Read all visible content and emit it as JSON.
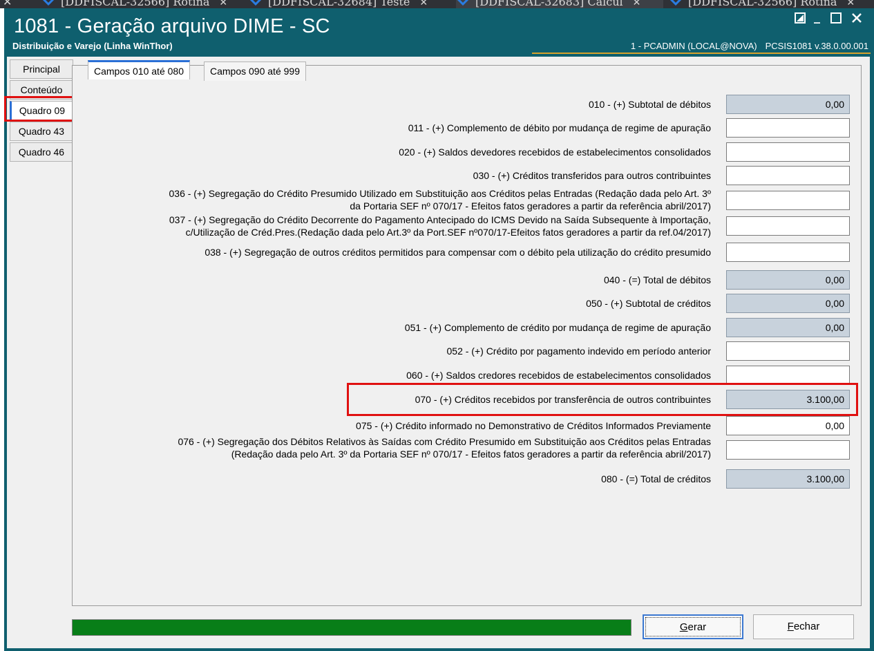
{
  "browser_tabs": [
    {
      "label": "[DDFISCAL-32566] Rotina"
    },
    {
      "label": "[DDFISCAL-32684] Teste"
    },
    {
      "label": "[DDFISCAL-32683] Calcul"
    },
    {
      "label": "[DDFISCAL-32566] Rotina"
    }
  ],
  "window": {
    "title": "1081 - Geração arquivo DIME - SC",
    "subtitle": "Distribuição e Varejo (Linha WinThor)",
    "user": "1 - PCADMIN (LOCAL@NOVA)",
    "system": "PCSIS1081  v.38.0.00.001"
  },
  "side_tabs": [
    {
      "label": "Principal"
    },
    {
      "label": "Conteúdo"
    },
    {
      "label": "Quadro 09"
    },
    {
      "label": "Quadro 43"
    },
    {
      "label": "Quadro 46"
    }
  ],
  "top_tabs": [
    {
      "label": "Campos 010 até 080"
    },
    {
      "label": "Campos 090 até 999"
    }
  ],
  "fields": [
    {
      "label": "010 - (+) Subtotal de débitos",
      "value": "0,00"
    },
    {
      "label": "011 - (+) Complemento de débito por mudança de regime de apuração",
      "value": ""
    },
    {
      "label": "020 - (+) Saldos devedores recebidos de estabelecimentos consolidados",
      "value": ""
    },
    {
      "label": "030 - (+) Créditos transferidos para outros contribuintes",
      "value": ""
    },
    {
      "label": "036 - (+) Segregação do Crédito Presumido Utilizado em Substituição aos Créditos pelas Entradas (Redação dada pelo Art. 3º",
      "label2": "da Portaria SEF nº 070/17 - Efeitos fatos geradores a partir da referência abril/2017)",
      "value": ""
    },
    {
      "label": "037 - (+) Segregação do Crédito Decorrente do Pagamento Antecipado do ICMS Devido na Saída Subsequente à Importação,",
      "label2": "c/Utilização de Créd.Pres.(Redação dada pelo Art.3º da Port.SEF nº070/17-Efeitos fatos geradores a partir da ref.04/2017)",
      "value": ""
    },
    {
      "label": "038 - (+) Segregação de outros créditos permitidos para compensar com o débito pela utilização do crédito presumido",
      "value": ""
    },
    {
      "label": "040 - (=) Total de débitos",
      "value": "0,00"
    },
    {
      "label": "050 - (+) Subtotal de créditos",
      "value": "0,00"
    },
    {
      "label": "051 - (+) Complemento de crédito por mudança de regime de apuração",
      "value": "0,00"
    },
    {
      "label": "052 - (+) Crédito por pagamento indevido em período anterior",
      "value": ""
    },
    {
      "label": "060 - (+) Saldos credores recebidos de estabelecimentos consolidados",
      "value": ""
    },
    {
      "label": "070 - (+) Créditos recebidos por transferência de outros contribuintes",
      "value": "3.100,00"
    },
    {
      "label": "075 - (+) Crédito informado no Demonstrativo de Créditos Informados Previamente",
      "value": "0,00"
    },
    {
      "label": "076 - (+) Segregação dos Débitos Relativos às Saídas com Crédito Presumido em Substituição aos Créditos pelas Entradas",
      "label2": "(Redação dada pelo Art. 3º da Portaria SEF nº 070/17 - Efeitos fatos geradores a partir da referência abril/2017)",
      "value": ""
    },
    {
      "label": "080 - (=) Total de créditos",
      "value": "3.100,00"
    }
  ],
  "progress": 1.0,
  "buttons": {
    "gerar_pre": "",
    "gerar_u": "G",
    "gerar_post": "erar",
    "fechar_u": "F",
    "fechar_post": "echar"
  },
  "colors": {
    "titlebar": "#0f5f6e",
    "progress": "#087e18",
    "highlight": "#e01010",
    "readonly_field": "#c8d2dc"
  }
}
